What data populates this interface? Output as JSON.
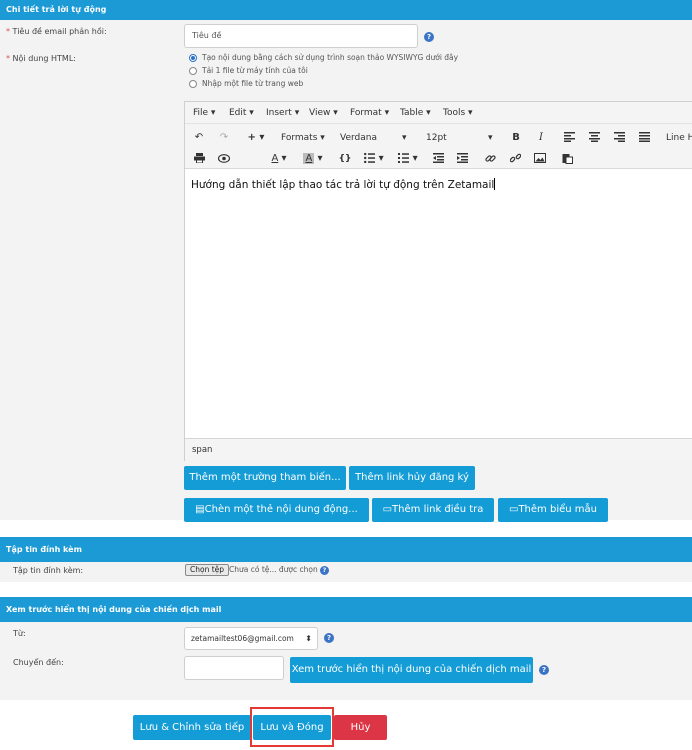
{
  "section_reply": {
    "title": "Chi tiết trả lời tự động",
    "subject_label": "Tiêu đề email phản hồi:",
    "subject_placeholder": "Tiêu đề",
    "html_label": "Nội dung HTML:",
    "required_mark": "*",
    "radio_options": [
      "Tạo nội dung bằng cách sử dụng trình soạn thảo WYSIWYG dưới đây",
      "Tải 1 file từ máy tính của tôi",
      "Nhập một file từ trang web"
    ],
    "help_glyph": "?"
  },
  "editor": {
    "menus": [
      "File",
      "Edit",
      "Insert",
      "View",
      "Format",
      "Table",
      "Tools"
    ],
    "formats_label": "Formats",
    "font_family": "Verdana",
    "font_size": "12pt",
    "line_height_label": "Line H",
    "content_text": "Hướng dẫn thiết lập thao tác trả lời tự động trên Zetamail",
    "status_path": "span",
    "icons": [
      "undo-icon",
      "redo-icon",
      "insert-plus-icon",
      "bold-icon",
      "italic-icon",
      "align-left-icon",
      "align-center-icon",
      "align-right-icon",
      "align-justify-icon",
      "print-icon",
      "preview-icon",
      "text-color-icon",
      "background-color-icon",
      "source-code-icon",
      "bullet-list-icon",
      "numbered-list-icon",
      "outdent-icon",
      "indent-icon",
      "link-icon",
      "unlink-icon",
      "image-icon",
      "paste-icon"
    ]
  },
  "insert_buttons": {
    "add_param": "Thêm một trường tham biến...",
    "add_unsubscribe": "Thêm link hủy đăng ký",
    "insert_dynamic": "Chèn một thẻ nội dung động...",
    "add_survey": "Thêm link điều tra",
    "add_form": "Thêm biểu mẫu"
  },
  "section_attach": {
    "title": "Tập tin đính kèm",
    "label": "Tập tin đính kèm:",
    "choose_file": "Chọn tệp",
    "no_file": "Chưa có tệ... được chọn"
  },
  "section_preview": {
    "title": "Xem trước hiển thị nội dung của chiến dịch mail",
    "from_label": "Từ:",
    "from_value": "zetamailtest06@gmail.com",
    "to_label": "Chuyển đến:",
    "to_value": "",
    "preview_button": "Xem trước hiển thị nội dung của chiến dịch mail"
  },
  "footer": {
    "save_continue": "Lưu & Chỉnh sửa tiếp",
    "save_close": "Lưu và Đóng",
    "cancel": "Hủy"
  },
  "colors": {
    "header_blue": "#1c9ad6",
    "button_blue": "#149cd6",
    "button_red": "#dc3545",
    "highlight_red": "#e53935"
  }
}
